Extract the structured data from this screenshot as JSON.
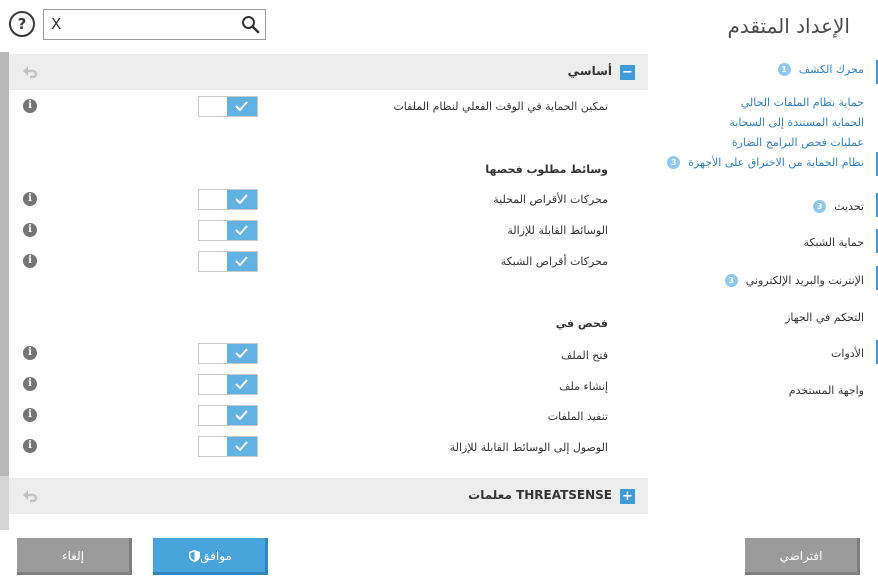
{
  "header": {
    "title": "الإعداد المتقدم",
    "search_clear": "X",
    "search_value": "",
    "help": "?"
  },
  "sections": {
    "basic": {
      "title": "أساسي",
      "toggle": "−"
    },
    "threatsense": {
      "title": "THREATSENSE معلمات",
      "toggle": "+"
    }
  },
  "settings": [
    {
      "label": "تمكين الحماية في الوقت الفعلي لنظام الملفات",
      "enabled": true
    },
    {
      "label": "محركات الأقراص المحلية",
      "enabled": true
    },
    {
      "label": "الوسائط القابلة للإزالة",
      "enabled": true
    },
    {
      "label": "محركات أقراص الشبكة",
      "enabled": true
    },
    {
      "label": "فتح الملف",
      "enabled": true
    },
    {
      "label": "إنشاء ملف",
      "enabled": true
    },
    {
      "label": "تنفيذ الملفات",
      "enabled": true
    },
    {
      "label": "الوصول إلى الوسائط القابلة للإزالة",
      "enabled": true
    }
  ],
  "groups": {
    "media": "وسائط مطلوب فحصها",
    "scan_on": "فحص في"
  },
  "sidebar": {
    "items": [
      {
        "label": "محرك الكشف",
        "badge": "1",
        "active": true
      },
      {
        "label": "حماية نظام الملفات الحالي"
      },
      {
        "label": "الحماية المستندة إلى السحابة"
      },
      {
        "label": "عمليات فحص البرامج الضارة"
      },
      {
        "label": "نظام الحماية من الاختراق على الأجهزة",
        "badge": "3"
      },
      {
        "label": "تحديث",
        "badge": "3"
      },
      {
        "label": "حماية الشبكة"
      },
      {
        "label": "الإنترنت والبريد الإلكتروني",
        "badge": "3"
      },
      {
        "label": "التحكم في الجهاز"
      },
      {
        "label": "الأدوات"
      },
      {
        "label": "واجهة المستخدم"
      }
    ]
  },
  "buttons": {
    "default": "افتراضي",
    "ok": "موافق",
    "cancel": "إلغاء"
  },
  "colors": {
    "accent": "#3f9cd9",
    "toggle_on": "#61b1e2",
    "button_gray": "#9b9b9b",
    "button_blue": "#4aa4dc"
  }
}
